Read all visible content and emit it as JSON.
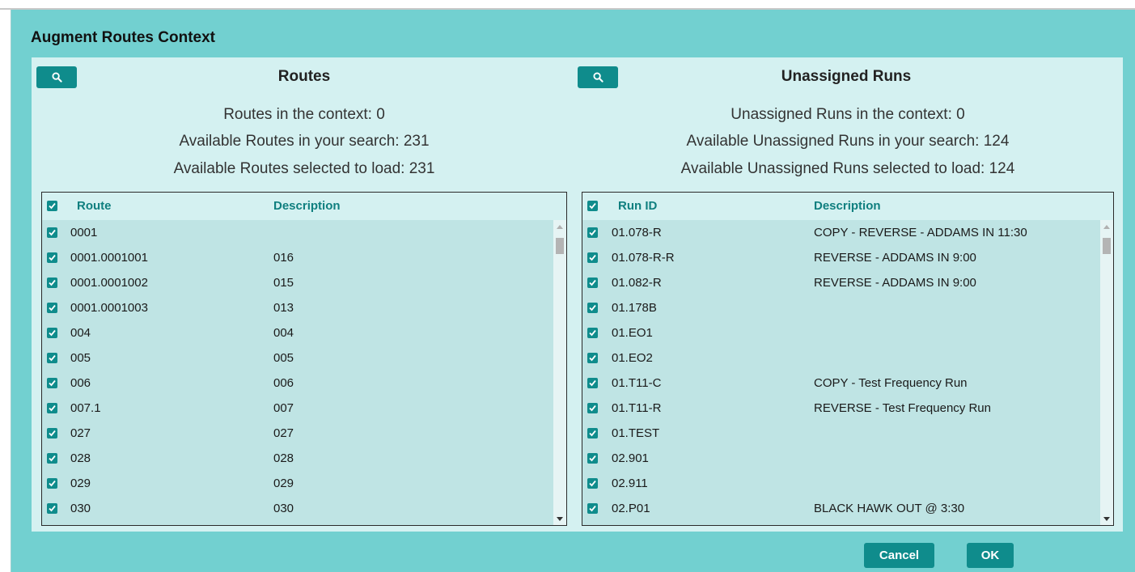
{
  "dialog": {
    "title": "Augment Routes Context"
  },
  "routes": {
    "title": "Routes",
    "stats": [
      "Routes in the context: 0",
      "Available Routes in your search: 231",
      "Available Routes selected to load: 231"
    ],
    "columns": [
      "Route",
      "Description"
    ],
    "rows": [
      [
        "0001",
        ""
      ],
      [
        "0001.0001001",
        "016"
      ],
      [
        "0001.0001002",
        "015"
      ],
      [
        "0001.0001003",
        "013"
      ],
      [
        "004",
        "004"
      ],
      [
        "005",
        "005"
      ],
      [
        "006",
        "006"
      ],
      [
        "007.1",
        "007"
      ],
      [
        "027",
        "027"
      ],
      [
        "028",
        "028"
      ],
      [
        "029",
        "029"
      ],
      [
        "030",
        "030"
      ]
    ]
  },
  "runs": {
    "title": "Unassigned Runs",
    "stats": [
      "Unassigned Runs in the context: 0",
      "Available Unassigned Runs in your search: 124",
      "Available Unassigned Runs selected to load: 124"
    ],
    "columns": [
      "Run ID",
      "Description"
    ],
    "rows": [
      [
        "01.078-R",
        "COPY - REVERSE - ADDAMS IN 11:30"
      ],
      [
        "01.078-R-R",
        "REVERSE - ADDAMS IN 9:00"
      ],
      [
        "01.082-R",
        "REVERSE - ADDAMS IN 9:00"
      ],
      [
        "01.178B",
        ""
      ],
      [
        "01.EO1",
        ""
      ],
      [
        "01.EO2",
        ""
      ],
      [
        "01.T11-C",
        "COPY - Test Frequency Run"
      ],
      [
        "01.T11-R",
        "REVERSE - Test Frequency Run"
      ],
      [
        "01.TEST",
        ""
      ],
      [
        "02.901",
        ""
      ],
      [
        "02.911",
        ""
      ],
      [
        "02.P01",
        "BLACK HAWK OUT @ 3:30"
      ]
    ]
  },
  "buttons": {
    "cancel": "Cancel",
    "ok": "OK"
  },
  "icons": {
    "search": "search-icon",
    "checkbox": "checkbox-checked-icon",
    "scroll_up": "scroll-up-arrow-icon",
    "scroll_down": "scroll-down-arrow-icon"
  },
  "colors": {
    "dialog_bg": "#72d0d0",
    "content_bg": "#d4f1f1",
    "accent": "#0f8c8c",
    "grid_bg": "#bfe4e4",
    "header_text": "#0f7f7f"
  }
}
